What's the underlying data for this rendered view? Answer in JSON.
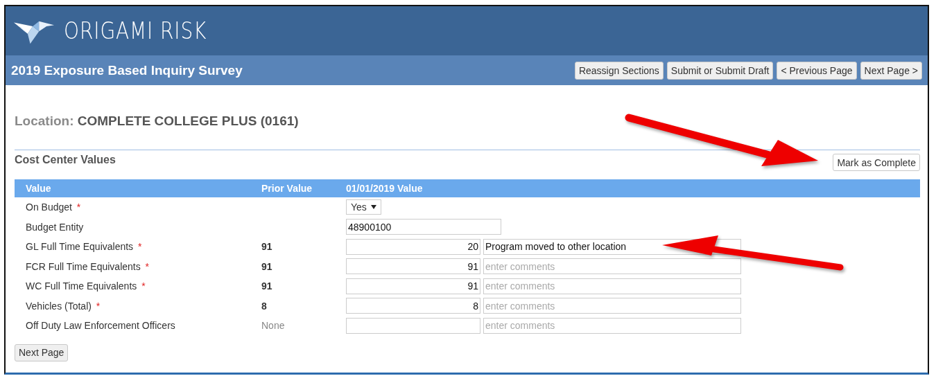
{
  "brand": {
    "name": "ORIGAMI RISK"
  },
  "title_bar": {
    "title": "2019 Exposure Based Inquiry Survey",
    "buttons": [
      "Reassign Sections",
      "Submit or Submit Draft",
      "< Previous Page",
      "Next Page >"
    ]
  },
  "location": {
    "label": "Location:",
    "value": "COMPLETE COLLEGE PLUS (0161)"
  },
  "section": {
    "title": "Cost Center Values",
    "action": "Mark as Complete"
  },
  "table": {
    "columns": [
      "Value",
      "Prior Value",
      "01/01/2019 Value"
    ],
    "rows": [
      {
        "kind": "select",
        "label": "On Budget",
        "required": true,
        "value": "Yes"
      },
      {
        "kind": "text",
        "label": "Budget Entity",
        "required": false,
        "value": "48900100"
      },
      {
        "kind": "number",
        "label": "GL Full Time Equivalents",
        "required": true,
        "prior": "91",
        "prior_bold": true,
        "value": "20",
        "comment": "Program moved to other location"
      },
      {
        "kind": "number",
        "label": "FCR Full Time Equivalents",
        "required": true,
        "prior": "91",
        "prior_bold": true,
        "value": "91",
        "comment_placeholder": "enter comments"
      },
      {
        "kind": "number",
        "label": "WC Full Time Equivalents",
        "required": true,
        "prior": "91",
        "prior_bold": true,
        "value": "91",
        "comment_placeholder": "enter comments"
      },
      {
        "kind": "number",
        "label": "Vehicles (Total)",
        "required": true,
        "prior": "8",
        "prior_bold": true,
        "value": "8",
        "comment_placeholder": "enter comments"
      },
      {
        "kind": "number",
        "label": "Off Duty Law Enforcement Officers",
        "required": false,
        "prior": "None",
        "prior_bold": false,
        "comment_placeholder": "enter comments"
      }
    ]
  },
  "footer": {
    "button": "Next Page"
  },
  "required_mark": "*"
}
